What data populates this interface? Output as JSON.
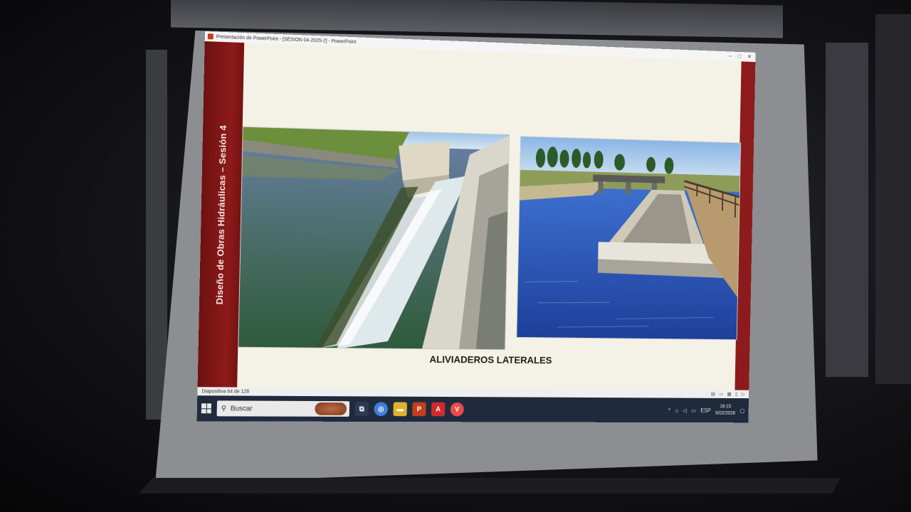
{
  "window": {
    "title": "Presentación de PowerPoint - [SESION 04-2025-2] - PowerPoint",
    "controls": [
      "–",
      "□",
      "✕"
    ]
  },
  "slide": {
    "side_title": "Diseño de Obras Hidráulicas – Sesión 4",
    "caption": "ALIVIADEROS LATERALES",
    "photos": [
      {
        "name": "left-photo",
        "description_icon": "canal-spillway-photo"
      },
      {
        "name": "right-photo",
        "description_icon": "lateral-weir-photo"
      }
    ]
  },
  "statusbar": {
    "slide_counter": "Diapositiva 64 de 128"
  },
  "taskbar": {
    "search_placeholder": "Buscar",
    "apps": [
      {
        "icon": "task-view-icon",
        "color": "#2b3a52"
      },
      {
        "icon": "chrome-icon",
        "color": "#3f7fd6"
      },
      {
        "icon": "file-explorer-icon",
        "color": "#e0b12a"
      },
      {
        "icon": "powerpoint-icon",
        "color": "#c43e1c",
        "label": "P"
      },
      {
        "icon": "acrobat-icon",
        "color": "#d12b2b",
        "label": "A"
      },
      {
        "icon": "vivaldi-icon",
        "color": "#e84a4a",
        "label": "V"
      }
    ],
    "language": "ESP",
    "time": "18:15",
    "date": "5/02/2026"
  }
}
